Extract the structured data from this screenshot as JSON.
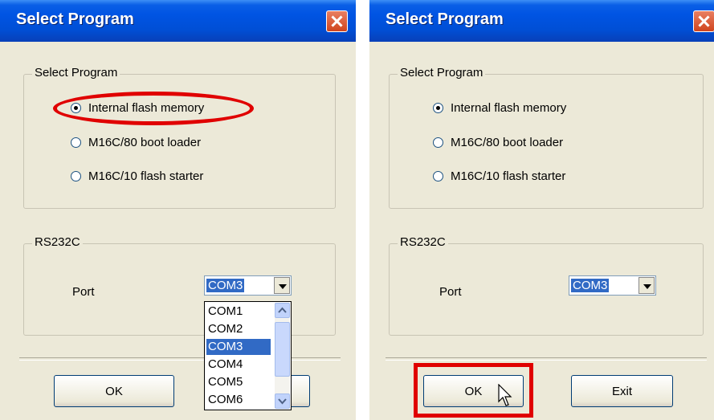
{
  "left_dialog": {
    "title": "Select Program",
    "program_group": {
      "legend": "Select Program",
      "options": [
        "Internal flash memory",
        "M16C/80 boot loader",
        "M16C/10 flash starter"
      ],
      "selected": 0
    },
    "rs232c_group": {
      "legend": "RS232C",
      "port_label": "Port",
      "port_value": "COM3"
    },
    "dropdown_options": [
      "COM1",
      "COM2",
      "COM3",
      "COM4",
      "COM5",
      "COM6"
    ],
    "dropdown_selected": "COM3",
    "ok_label": "OK"
  },
  "right_dialog": {
    "title": "Select Program",
    "program_group": {
      "legend": "Select Program",
      "options": [
        "Internal flash memory",
        "M16C/80 boot loader",
        "M16C/10 flash starter"
      ],
      "selected": 0
    },
    "rs232c_group": {
      "legend": "RS232C",
      "port_label": "Port",
      "port_value": "COM3"
    },
    "ok_label": "OK",
    "exit_label": "Exit"
  },
  "colors": {
    "titlebar": "#0054e3",
    "dialog_bg": "#ece9d8",
    "highlight": "#316ac5",
    "annotation_red": "#e00000"
  },
  "icons": [
    "close-icon",
    "chevron-down-icon",
    "chevron-up-icon",
    "mouse-cursor-icon"
  ]
}
